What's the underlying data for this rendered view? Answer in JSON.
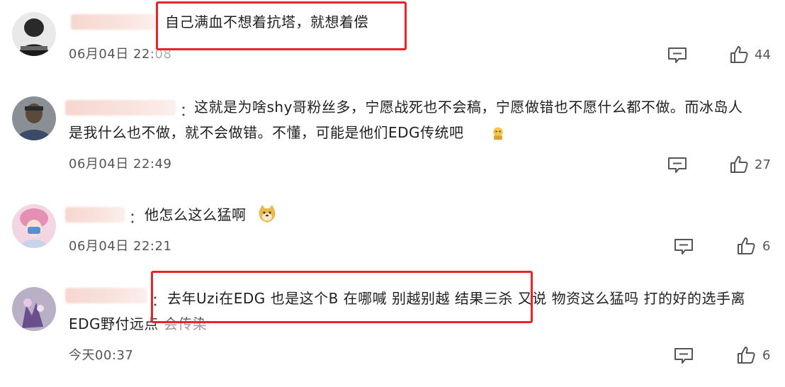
{
  "comments": [
    {
      "text_lines": [
        "自己满血不想着抗塔，就想着偿"
      ],
      "time": "06月04日 22:08",
      "likes": "44"
    },
    {
      "colon": "：",
      "text_lines": [
        "这就是为啥shy哥粉丝多，宁愿战死也不会稿，宁愿做错也不愿什么都不做。而冰岛人",
        "是我什么也不做，就不会做错。不懂，可能是他们EDG传统吧"
      ],
      "time": "06月04日 22:49",
      "likes": "27"
    },
    {
      "colon": "：",
      "text_lines": [
        "他怎么这么猛啊"
      ],
      "time": "06月04日 22:21",
      "likes": "6"
    },
    {
      "colon": "：",
      "text_lines": [
        "去年Uzi在EDG 也是这个B 在哪喊 别越别越 结果三杀 又说 物资这么猛吗 打的好的选手离",
        "EDG野付远点 会传染"
      ],
      "time": "今天00:37",
      "likes": "6"
    }
  ],
  "colors": {
    "highlight": "#e8232b",
    "text": "#1f1f1f",
    "meta": "#555555"
  },
  "icons": {
    "reply": "comment-reply-icon",
    "like": "thumbs-up-icon"
  }
}
